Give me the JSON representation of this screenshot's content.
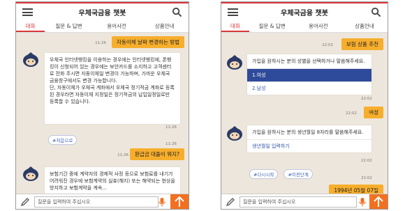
{
  "left": {
    "title": "우체국금융 챗봇",
    "tabs": [
      "대화",
      "질문 & 답변",
      "용어사전",
      "상품안내"
    ],
    "messages": {
      "u1": "자동이체 날짜 변경하는 방법",
      "t1": "11:26",
      "b1": "우체국 인터넷뱅킹을 이용하는 경우에는 인터넷뱅킹에, 폰뱅킹이 신청되어 있는 경우에는 보안카드를 소지하고 고객센터로 전화 주시면 자동이체일 변경이 가능하며, 가까운 우체국 금융창구에서도 변경 가능합니다.\n단, 자동이체가 우체국 계좌에서 우체국 정기적금 계좌로 등록된 경우라면 자동이체 지정일은 정기적금의 납입일정일로만 등록할 수 있습니다.",
      "t2": "11:26",
      "chip1": "#처음으로",
      "u2": "환급금 대출이 뭐지?",
      "t3": "11:26",
      "b2": "보험기간 중에 계약자의 경제적 사정 등으로 보험료를 내기가 어려워진 경우에 보험계약의 실효(해지) 또는 해약되는 현상을 방지하고 보험계약을 계속..."
    },
    "input_placeholder": "질문을 입력하여 주십시오"
  },
  "right": {
    "title": "우체국금융 챗봇",
    "tabs": [
      "대화",
      "질문 & 답변",
      "용어사전",
      "상품안내"
    ],
    "messages": {
      "u1": "보험 상품 추천",
      "t1": "22:02",
      "b1": "가입을 원하시는 분의 성별을 선택하거나 말씀해주세요.",
      "opt1": "1.여성",
      "opt2": "2.남성",
      "t2": "22:02",
      "u2": "여성",
      "t3": "22:02",
      "b2": "가입을 원하시는 분의 생년월일 8자리를 말씀해주세요.",
      "b2link": "생년월일 입력하기",
      "t4": "22:02",
      "chip1": "#다시시작",
      "chip2": "#이전단계",
      "t5": "22:02",
      "u3": "1994년 05월 07일",
      "t6": "22:02"
    },
    "input_placeholder": "질문을 입력하여 주십시오"
  },
  "colors": {
    "accent": "#d9373a",
    "user_bubble": "#f7ae2c",
    "send": "#f37021",
    "chat_bg": "#ede6dc"
  }
}
